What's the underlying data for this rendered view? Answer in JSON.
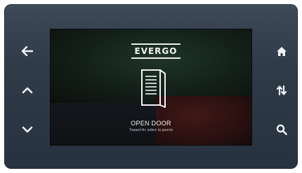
{
  "brand": {
    "logo_text": "EVERGO"
  },
  "screen": {
    "title": "OPEN DOOR",
    "subtitle": "Toque/clic sobre la puerta"
  },
  "buttons": {
    "left": [
      "arrow-left-icon",
      "chevron-up-icon",
      "chevron-down-icon"
    ],
    "right": [
      "home-icon",
      "swap-arrows-icon",
      "search-icon"
    ]
  },
  "colors": {
    "bezel": "#2f3a47",
    "screen": "#0e0f10",
    "icon": "#eef2f5"
  }
}
